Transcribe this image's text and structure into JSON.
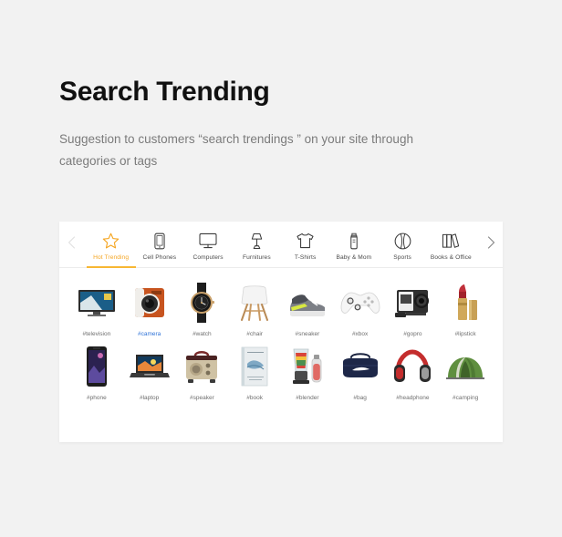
{
  "section": {
    "title": "Search Trending",
    "subtitle": "Suggestion to customers “search trendings ” on your site through categories or tags"
  },
  "colors": {
    "page_background": "#f2f2f2",
    "card_background": "#ffffff",
    "accent_orange": "#f5a623",
    "underline_orange": "#f7b733",
    "highlight_blue": "#2f73d8",
    "title_text": "#111111",
    "subtitle_text": "#7b7b7b",
    "tab_label_text": "#4a4a4a",
    "tag_text": "#6f6f6f",
    "divider": "#ececec"
  },
  "carousel": {
    "prev_icon": "chevron-left-icon",
    "next_icon": "chevron-right-icon",
    "prev_enabled": false,
    "next_enabled": true
  },
  "tabs": [
    {
      "label": "Hot Trending",
      "icon": "star-icon",
      "active": true
    },
    {
      "label": "Cell Phones",
      "icon": "phone-icon",
      "active": false
    },
    {
      "label": "Computers",
      "icon": "monitor-icon",
      "active": false
    },
    {
      "label": "Furnitures",
      "icon": "lamp-icon",
      "active": false
    },
    {
      "label": "T-Shirts",
      "icon": "tshirt-icon",
      "active": false
    },
    {
      "label": "Baby & Mom",
      "icon": "baby-bottle-icon",
      "active": false
    },
    {
      "label": "Sports",
      "icon": "ball-icon",
      "active": false
    },
    {
      "label": "Books & Office",
      "icon": "books-icon",
      "active": false
    }
  ],
  "products": [
    {
      "tag": "#television",
      "image": "television-image",
      "highlight": false
    },
    {
      "tag": "#camera",
      "image": "camera-image",
      "highlight": true
    },
    {
      "tag": "#watch",
      "image": "watch-image",
      "highlight": false
    },
    {
      "tag": "#chair",
      "image": "chair-image",
      "highlight": false
    },
    {
      "tag": "#sneaker",
      "image": "sneaker-image",
      "highlight": false
    },
    {
      "tag": "#xbox",
      "image": "xbox-controller-image",
      "highlight": false
    },
    {
      "tag": "#gopro",
      "image": "gopro-camera-image",
      "highlight": false
    },
    {
      "tag": "#lipstick",
      "image": "lipstick-image",
      "highlight": false
    },
    {
      "tag": "#phone",
      "image": "smartphone-image",
      "highlight": false
    },
    {
      "tag": "#laptop",
      "image": "laptop-image",
      "highlight": false
    },
    {
      "tag": "#speaker",
      "image": "speaker-image",
      "highlight": false
    },
    {
      "tag": "#book",
      "image": "book-image",
      "highlight": false
    },
    {
      "tag": "#blender",
      "image": "blender-image",
      "highlight": false
    },
    {
      "tag": "#bag",
      "image": "duffel-bag-image",
      "highlight": false
    },
    {
      "tag": "#headphone",
      "image": "headphones-image",
      "highlight": false
    },
    {
      "tag": "#camping",
      "image": "tent-image",
      "highlight": false
    }
  ]
}
